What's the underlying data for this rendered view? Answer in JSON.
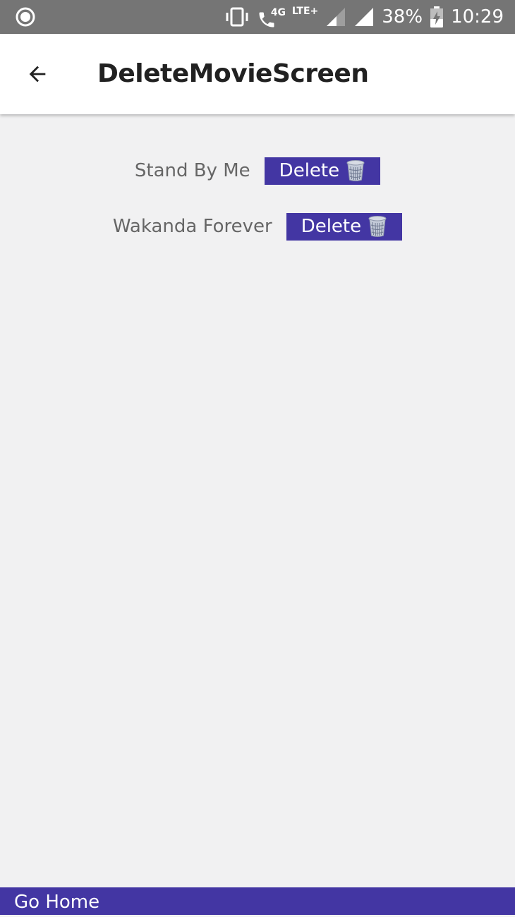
{
  "status_bar": {
    "network_label": "4G",
    "lte_label": "LTE+",
    "battery_percent": "38%",
    "time": "10:29",
    "icons": [
      "record-icon",
      "vibrate-icon",
      "wifi-calling-icon",
      "signal-icon",
      "signal-icon",
      "battery-charging-icon"
    ]
  },
  "app_bar": {
    "title": "DeleteMovieScreen",
    "back_icon": "arrow-back-icon"
  },
  "movies": [
    {
      "title": "Stand By Me",
      "delete_label": "Delete"
    },
    {
      "title": "Wakanda Forever",
      "delete_label": "Delete"
    }
  ],
  "footer": {
    "go_home_label": "Go Home"
  },
  "colors": {
    "status_bar": "#757575",
    "background": "#f1f1f2",
    "accent": "#4336a3",
    "title_text": "#212121",
    "movie_text": "#666666"
  }
}
